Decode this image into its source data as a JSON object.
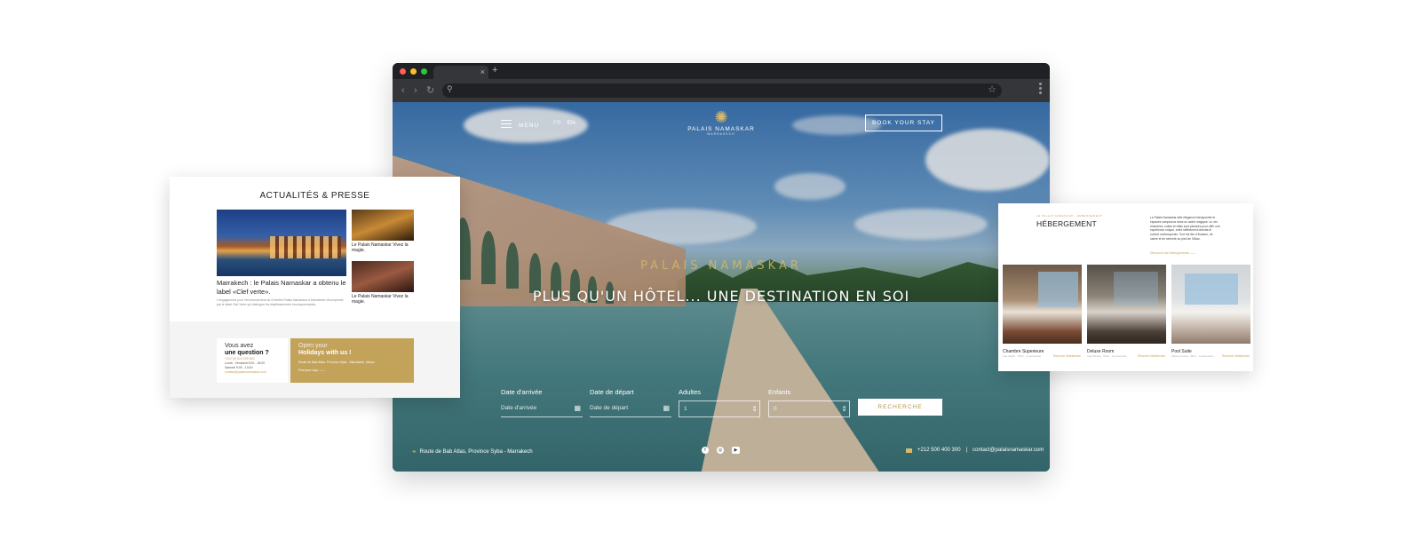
{
  "browser": {
    "tab_close": "×",
    "tab_new": "+",
    "nav_back": "‹",
    "nav_forward": "›",
    "nav_reload": "↻",
    "search_glyph": "⚲",
    "star_glyph": "☆",
    "icons": [
      "close-icon",
      "plus-icon",
      "back-icon",
      "forward-icon",
      "reload-icon",
      "search-icon",
      "star-icon",
      "kebab-icon"
    ]
  },
  "hero": {
    "menu_label": "MENU",
    "lang": [
      "FR",
      "EN"
    ],
    "logo_mark": "✺",
    "logo_name": "PALAIS NAMASKAR",
    "logo_sub": "MARRAKECH",
    "book_label": "BOOK YOUR STAY",
    "kicker": "PALAIS NAMASKAR",
    "headline": "PLUS QU'UN HÔTEL... UNE DESTINATION EN SOI",
    "search": {
      "arrival_label": "Date d'arrivée",
      "arrival_placeholder": "Date d'arrivée",
      "departure_label": "Date de départ",
      "departure_placeholder": "Date de départ",
      "adults_label": "Adultes",
      "adults_value": "1",
      "children_label": "Enfants",
      "children_value": "0",
      "calendar_glyph": "▦",
      "stepper_glyph": "⇕",
      "button": "RECHERCHE"
    },
    "footer": {
      "pin_glyph": "⌖",
      "address": "Route de Bab Atlas, Province Syba - Marrakech",
      "social": [
        "f",
        "◎",
        "▶"
      ],
      "phone": "+212 500 400 300",
      "separator": "|",
      "email": "contact@palaisnamaskar.com"
    },
    "colors": {
      "gold": "#d7b96a",
      "button_text": "#b8934a"
    }
  },
  "news_card": {
    "title": "ACTUALITÉS & PRESSE",
    "main_title": "Marrakech : le Palais Namaskar a obtenu le label «Clef verte».",
    "main_excerpt": "L'engagement pour l'environnement du 5 étoiles Palais Namaskar à Marrakech récompensé par le label Clef Verte qui distingue les établissements écoresponsables.",
    "small1": "Le Palais Namaskar Vivez la magie.",
    "small2": "Le Palais Namaskar Vivez la magie.",
    "question_l1": "Vous avez",
    "question_l2": "une question ?",
    "question_phone": "+212 (0) 524 299 800",
    "question_hours1": "Lundi - Vendredi 9:00 - 18:00",
    "question_hours2": "Samedi 9:00 - 13:00",
    "question_email": "contact@palaisnamaskar.com",
    "open_l1": "Open your",
    "open_l2": "Holidays with us !",
    "open_address": "Route de Bab Atlas, Province Syba - Marrakech, Maroc",
    "open_link": "Find your way  ——",
    "colors": {
      "gold": "#c3a25a"
    }
  },
  "rooms_card": {
    "kicker": "LE PALAIS NAMASKAR  ·  HÉBERGEMENT",
    "title": "HÉBERGEMENT",
    "text": "Le Palais Namaskar allie élégance intemporelle et espaces somptueux dans un cadre magique. Ici, les chambres, suites et villas sont pensées pour offrir une expérience unique, entre raffinement oriental et confort contemporain. Tout est lieu d'évasion, de calme et de sérénité au pied de l'Atlas.",
    "link": "Découvrir les hébergements  ——",
    "rooms": [
      {
        "name": "Chambre Superieure",
        "sub": "Vue Jardin · 55m² · 2 personnes",
        "book": "Réserver Maintenant"
      },
      {
        "name": "Deluxe Room",
        "sub": "Vue Piscine · 65m² · 2 personnes",
        "book": "Réserver Maintenant"
      },
      {
        "name": "Pool Suite",
        "sub": "Piscine privée · 90m² · 3 personnes",
        "book": "Réserver Maintenant"
      }
    ]
  }
}
